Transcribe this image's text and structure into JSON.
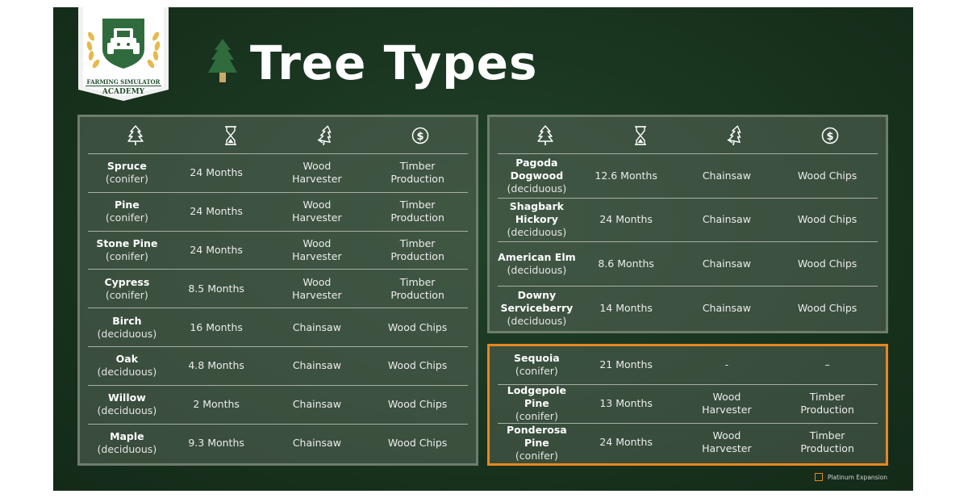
{
  "brand": {
    "line1": "FARMING SIMULATOR",
    "line2": "ACADEMY"
  },
  "title": "Tree Types",
  "colors": {
    "board": "#19341f",
    "panel_border": "#6e7d6e",
    "expansion_border": "#e9871e",
    "text": "#ffffff"
  },
  "header_icons": [
    "tree-icon",
    "hourglass-icon",
    "felled-tree-icon",
    "dollar-coin-icon"
  ],
  "left_table": [
    {
      "name": "Spruce",
      "type": "(conifer)",
      "growth": "24 Months",
      "tool": "Wood Harvester",
      "use": "Timber Production"
    },
    {
      "name": "Pine",
      "type": "(conifer)",
      "growth": "24 Months",
      "tool": "Wood Harvester",
      "use": "Timber Production"
    },
    {
      "name": "Stone Pine",
      "type": "(conifer)",
      "growth": "24 Months",
      "tool": "Wood Harvester",
      "use": "Timber Production"
    },
    {
      "name": "Cypress",
      "type": "(conifer)",
      "growth": "8.5 Months",
      "tool": "Wood Harvester",
      "use": "Timber Production"
    },
    {
      "name": "Birch",
      "type": "(deciduous)",
      "growth": "16 Months",
      "tool": "Chainsaw",
      "use": "Wood Chips"
    },
    {
      "name": "Oak",
      "type": "(deciduous)",
      "growth": "4.8 Months",
      "tool": "Chainsaw",
      "use": "Wood Chips"
    },
    {
      "name": "Willow",
      "type": "(deciduous)",
      "growth": "2 Months",
      "tool": "Chainsaw",
      "use": "Wood Chips"
    },
    {
      "name": "Maple",
      "type": "(deciduous)",
      "growth": "9.3 Months",
      "tool": "Chainsaw",
      "use": "Wood Chips"
    }
  ],
  "right_table": [
    {
      "name": "Pagoda Dogwood",
      "type": "(deciduous)",
      "growth": "12.6 Months",
      "tool": "Chainsaw",
      "use": "Wood Chips"
    },
    {
      "name": "Shagbark Hickory",
      "type": "(deciduous)",
      "growth": "24 Months",
      "tool": "Chainsaw",
      "use": "Wood Chips"
    },
    {
      "name": "American Elm",
      "type": "(deciduous)",
      "growth": "8.6 Months",
      "tool": "Chainsaw",
      "use": "Wood Chips"
    },
    {
      "name": "Downy Serviceberry",
      "type": "(deciduous)",
      "growth": "14 Months",
      "tool": "Chainsaw",
      "use": "Wood Chips"
    }
  ],
  "expansion_table": [
    {
      "name": "Sequoia",
      "type": "(conifer)",
      "growth": "21 Months",
      "tool": "-",
      "use": "–"
    },
    {
      "name": "Lodgepole Pine",
      "type": "(conifer)",
      "growth": "13 Months",
      "tool": "Wood Harvester",
      "use": "Timber Production"
    },
    {
      "name": "Ponderosa Pine",
      "type": "(conifer)",
      "growth": "24 Months",
      "tool": "Wood Harvester",
      "use": "Timber Production"
    }
  ],
  "legend": {
    "label": "Platinum Expansion"
  }
}
